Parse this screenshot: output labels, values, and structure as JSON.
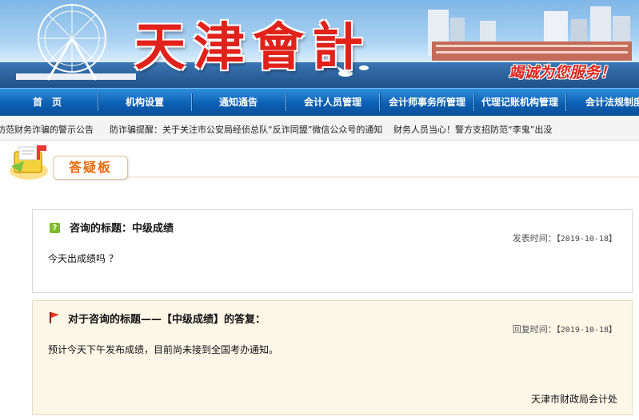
{
  "banner": {
    "title": "天津會計",
    "slogan": "竭诚为您服务！"
  },
  "nav": {
    "items": [
      "首　页",
      "机构设置",
      "通知通告",
      "会计人员管理",
      "会计师事务所管理",
      "代理记账机构管理",
      "会计法规制度"
    ]
  },
  "notice": {
    "items": [
      "防范财务诈骗的警示公告",
      "防诈骗提醒：关于关注市公安局经侦总队“反诈同盟”微信公众号的通知",
      "财务人员当心！警方支招防范“李鬼”出没"
    ]
  },
  "board": {
    "title": "答疑板"
  },
  "question": {
    "title": "咨询的标题：中级成绩",
    "date_label": "发表时间：",
    "date": "【2019-10-18】",
    "content": "今天出成绩吗 ？"
  },
  "reply": {
    "title": "对于咨询的标题——【中级成绩】的答复：",
    "date_label": "回复时间：",
    "date": "【2019-10-18】",
    "content": "预计今天下午发布成绩，目前尚未接到全国考办通知。",
    "signature": "天津市财政局会计处"
  },
  "colors": {
    "nav_blue": "#0d5fb3",
    "title_red": "#e0221b",
    "board_orange": "#e96c09",
    "question_icon_green": "#7dbb2b",
    "reply_bg": "#fdf7e8"
  },
  "icons": {
    "question": "question-mark-icon",
    "reply": "red-flag-icon",
    "board": "mailbox-icon"
  }
}
